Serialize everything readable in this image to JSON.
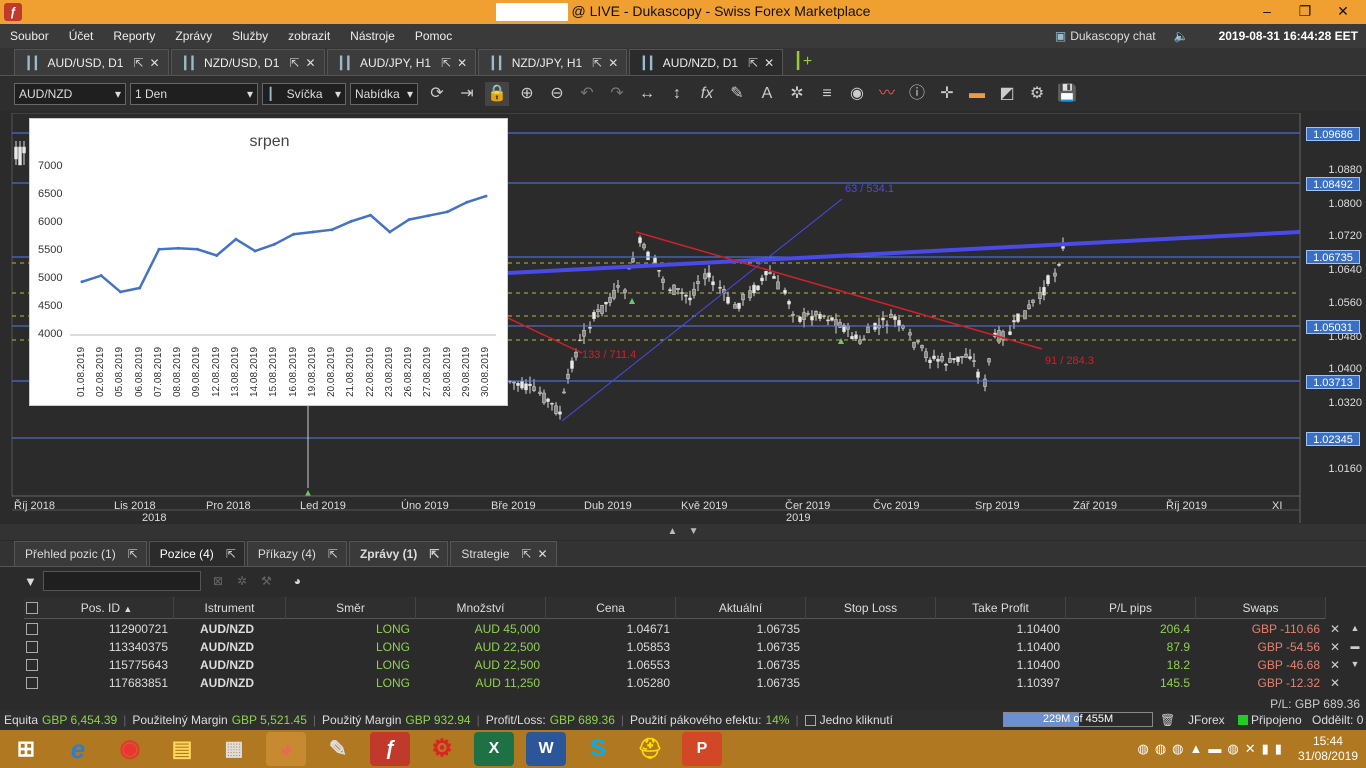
{
  "window": {
    "title": "@ LIVE - Dukascopy - Swiss Forex Marketplace",
    "minimize": "–",
    "maximize": "❐",
    "close": "✕"
  },
  "menu": [
    "Soubor",
    "Účet",
    "Reporty",
    "Zprávy",
    "Služby",
    "zobrazit",
    "Nástroje",
    "Pomoc"
  ],
  "header": {
    "chat": "Dukascopy chat",
    "datetime": "2019-08-31 16:44:28 EET"
  },
  "chart_tabs": [
    {
      "label": "AUD/USD, D1"
    },
    {
      "label": "NZD/USD, D1"
    },
    {
      "label": "AUD/JPY, H1"
    },
    {
      "label": "NZD/JPY, H1"
    },
    {
      "label": "AUD/NZD, D1"
    }
  ],
  "toolbar": {
    "instrument": "AUD/NZD",
    "period": "1 Den",
    "chart_type": "Svíčka",
    "offer_side": "Nabídka"
  },
  "chart": {
    "price_labels": [
      "1.0880",
      "1.0800",
      "1.0720",
      "1.0640",
      "1.0560",
      "1.0480",
      "1.0400",
      "1.0320",
      "1.0160"
    ],
    "price_boxes": [
      "1.09686",
      "1.08492",
      "1.06735",
      "1.05031",
      "1.03713",
      "1.02345"
    ],
    "months": [
      "Říj 2018",
      "Lis 2018",
      "Pro 2018",
      "Led 2019",
      "Úno 2019",
      "Bře 2019",
      "Dub 2019",
      "Kvě 2019",
      "Čer 2019",
      "Čvc 2019",
      "Srp 2019",
      "Zář 2019",
      "Říj 2019",
      "XI"
    ],
    "years": [
      "2018",
      "2019"
    ],
    "annotations": [
      "63 / 534.1",
      "133 / 711.4",
      "91 / 284.3"
    ]
  },
  "chart_data": {
    "type": "line",
    "title": "srpen",
    "categories": [
      "01.08.2019",
      "02.08.2019",
      "05.08.2019",
      "06.08.2019",
      "07.08.2019",
      "08.08.2019",
      "09.08.2019",
      "12.08.2019",
      "13.08.2019",
      "14.08.2019",
      "15.08.2019",
      "16.08.2019",
      "19.08.2019",
      "20.08.2019",
      "21.08.2019",
      "22.08.2019",
      "23.08.2019",
      "26.08.2019",
      "27.08.2019",
      "28.08.2019",
      "29.08.2019",
      "30.08.2019"
    ],
    "series": [
      {
        "values": [
          4950,
          5060,
          4770,
          4840,
          5530,
          5550,
          5530,
          5420,
          5710,
          5500,
          5620,
          5800,
          5840,
          5880,
          6030,
          6140,
          5840,
          6060,
          6130,
          6200,
          6370,
          6480
        ]
      }
    ],
    "y_ticks": [
      "7000",
      "6500",
      "6000",
      "5500",
      "5000",
      "4500",
      "4000"
    ],
    "ylim": [
      4000,
      7000
    ],
    "grid": false,
    "line_color": "#4472c4"
  },
  "bottom_tabs": [
    {
      "label": "Přehled pozic (1)"
    },
    {
      "label": "Pozice (4)"
    },
    {
      "label": "Příkazy (4)"
    },
    {
      "label": "Zprávy (1)"
    },
    {
      "label": "Strategie"
    }
  ],
  "positions": {
    "columns": [
      "Pos. ID",
      "Istrument",
      "Směr",
      "Množství",
      "Cena",
      "Aktuální",
      "Stop Loss",
      "Take Profit",
      "P/L pips",
      "Swaps"
    ],
    "rows": [
      {
        "id": "112900721",
        "instrument": "AUD/NZD",
        "side": "LONG",
        "amount": "AUD 45,000",
        "price": "1.04671",
        "current": "1.06735",
        "sl": "",
        "tp": "1.10400",
        "pips": "206.4",
        "swaps": "GBP -110.66"
      },
      {
        "id": "113340375",
        "instrument": "AUD/NZD",
        "side": "LONG",
        "amount": "AUD 22,500",
        "price": "1.05853",
        "current": "1.06735",
        "sl": "",
        "tp": "1.10400",
        "pips": "87.9",
        "swaps": "GBP -54.56"
      },
      {
        "id": "115775643",
        "instrument": "AUD/NZD",
        "side": "LONG",
        "amount": "AUD 22,500",
        "price": "1.06553",
        "current": "1.06735",
        "sl": "",
        "tp": "1.10400",
        "pips": "18.2",
        "swaps": "GBP -46.68"
      },
      {
        "id": "117683851",
        "instrument": "AUD/NZD",
        "side": "LONG",
        "amount": "AUD 11,250",
        "price": "1.05280",
        "current": "1.06735",
        "sl": "",
        "tp": "1.10397",
        "pips": "145.5",
        "swaps": "GBP -12.32"
      }
    ]
  },
  "pl_total": "P/L: GBP 689.36",
  "status": {
    "equity_label": "Equita",
    "equity": "GBP 6,454.39",
    "used_margin_label": "Použitelný Margin",
    "used_margin": "GBP 5,521.45",
    "margin_label": "Použitý Margin",
    "margin": "GBP 932.94",
    "pl_label": "Profit/Loss:",
    "pl": "GBP 689.36",
    "leverage_label": "Použití pákového efektu:",
    "leverage": "14%",
    "one_click": "Jedno kliknutí",
    "memory": "229M of 455M",
    "platform": "JForex",
    "connected": "Připojeno",
    "sent": "Odděilt: 0"
  },
  "taskbar": {
    "time": "15:44",
    "date": "31/08/2019"
  }
}
